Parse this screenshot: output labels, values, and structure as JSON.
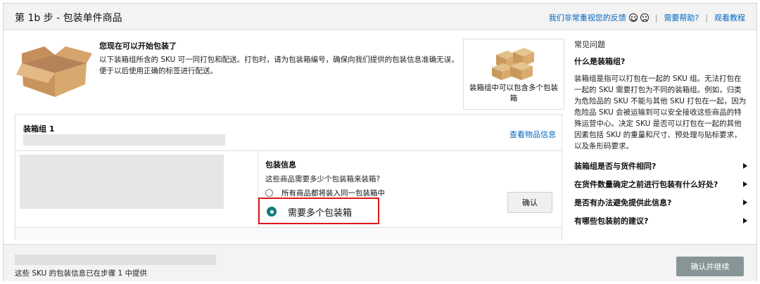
{
  "header": {
    "step_title": "第 1b 步 - 包装单件商品",
    "feedback_link": "我们非常重视您的反馈",
    "help_link": "需要帮助?",
    "tutorial_link": "观看教程"
  },
  "intro": {
    "title": "您现在可以开始包装了",
    "text": "以下装箱组所含的 SKU 可一同打包和配送。打包时，请为包装箱编号，确保向我们提供的包装信息准确无误，便于以后使用正确的标签进行配送。"
  },
  "multi_box_card": {
    "caption": "装箱组中可以包含多个包装箱"
  },
  "box_group": {
    "title": "装箱组 1",
    "view_items_link": "查看物品信息",
    "pack_info": {
      "title": "包装信息",
      "question": "这些商品需要多少个包装箱来装箱?",
      "option_single": "所有商品都将装入同一包装箱中",
      "option_multiple": "需要多个包装箱",
      "confirm_label": "确认"
    }
  },
  "faq": {
    "heading": "常见问题",
    "q1": "什么是装箱组?",
    "a1": "装箱组是指可以打包在一起的 SKU 组。无法打包在一起的 SKU 需要打包为不同的装箱组。例如，归类为危险品的 SKU 不能与其他 SKU 打包在一起，因为危险品 SKU 会被运输到可以安全接收这些商品的特殊运营中心。决定 SKU 是否可以打包在一起的其他因素包括 SKU 的重量和尺寸、预处理与贴标要求，以及条形码要求。",
    "items": [
      "装箱组是否与货件相同?",
      "在货件数量确定之前进行包装有什么好处?",
      "是否有办法避免提供此信息?",
      "有哪些包装前的建议?"
    ]
  },
  "footer": {
    "status_text": "这些 SKU 的包装信息已在步骤 1 中提供",
    "continue_label": "确认并继续"
  },
  "colors": {
    "accent_teal": "#127c7d",
    "highlight_red": "#e01616",
    "link_blue": "#0066c0",
    "continue_gray": "#879596"
  }
}
